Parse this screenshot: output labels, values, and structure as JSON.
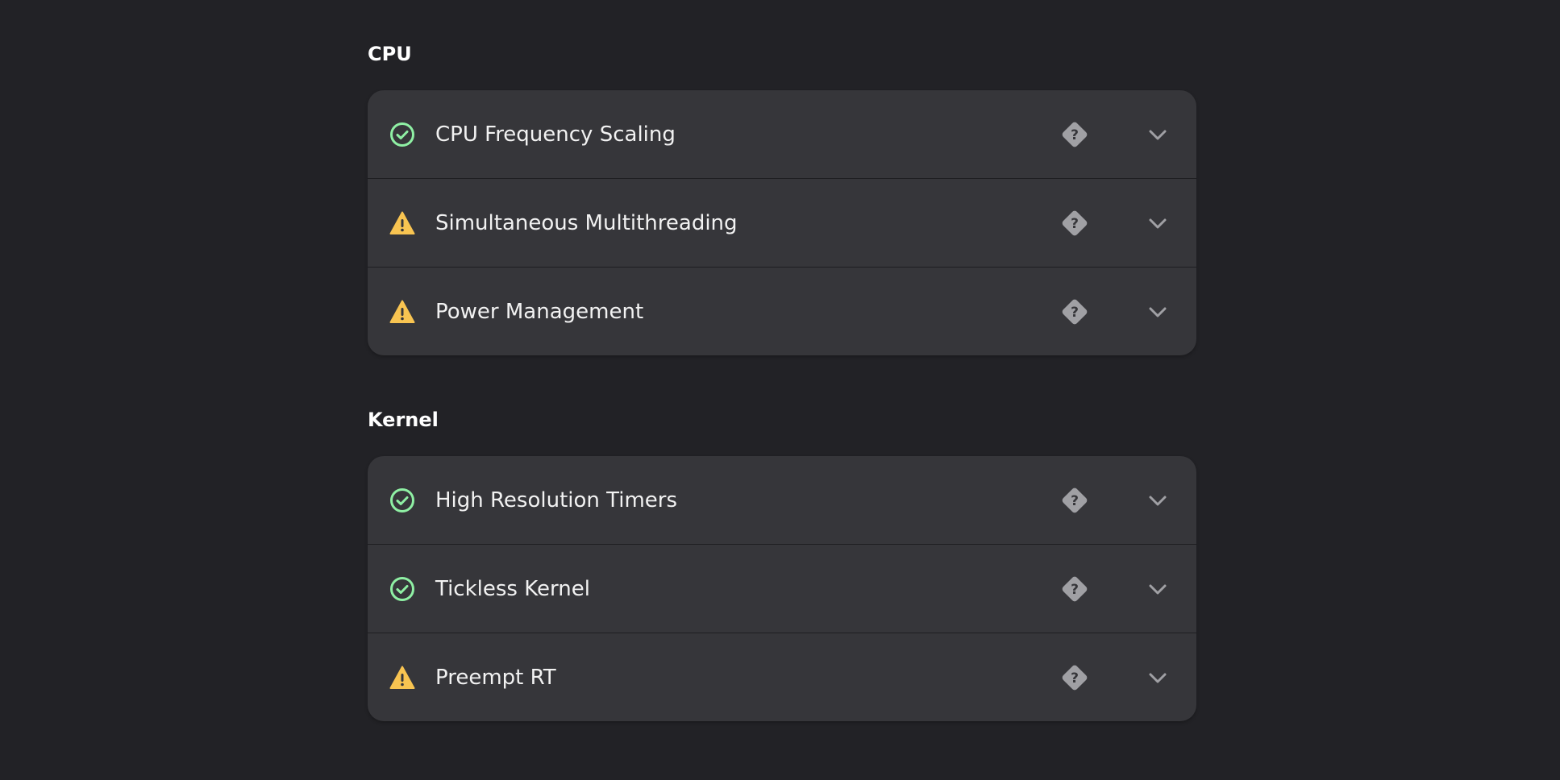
{
  "colors": {
    "background": "#222226",
    "card": "#36363a",
    "success": "#8ff0a4",
    "warning": "#f8c451",
    "muted_icon": "#a0a0a4"
  },
  "sections": [
    {
      "title": "CPU",
      "items": [
        {
          "label": "CPU Frequency Scaling",
          "status": "success",
          "icon": "check-circle-icon"
        },
        {
          "label": "Simultaneous Multithreading",
          "status": "warning",
          "icon": "warning-triangle-icon"
        },
        {
          "label": "Power Management",
          "status": "warning",
          "icon": "warning-triangle-icon"
        }
      ]
    },
    {
      "title": "Kernel",
      "items": [
        {
          "label": "High Resolution Timers",
          "status": "success",
          "icon": "check-circle-icon"
        },
        {
          "label": "Tickless Kernel",
          "status": "success",
          "icon": "check-circle-icon"
        },
        {
          "label": "Preempt RT",
          "status": "warning",
          "icon": "warning-triangle-icon"
        }
      ]
    }
  ],
  "row_actions": {
    "help_icon": "help-diamond-icon",
    "expand_icon": "chevron-down-icon"
  }
}
